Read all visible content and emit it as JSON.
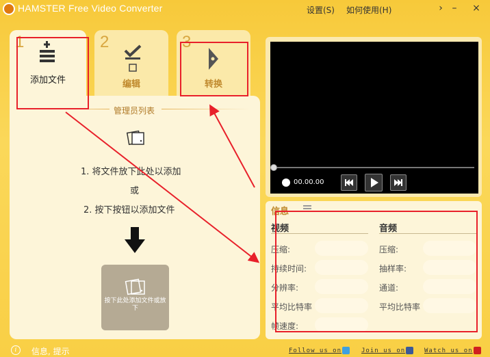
{
  "app": {
    "title": "HAMSTER Free Video Converter",
    "menu": {
      "settings": "设置(S)",
      "howto": "如何使用(H)"
    },
    "window_controls": {
      "arrow": "›",
      "minimize": "–",
      "close": "×"
    }
  },
  "tabs": [
    {
      "number": "1",
      "label": "添加文件",
      "icon": "file-list-add-icon"
    },
    {
      "number": "2",
      "label": "编辑",
      "icon": "checklist-icon"
    },
    {
      "number": "3",
      "label": "转换",
      "icon": "play-arrow-icon"
    }
  ],
  "file_list": {
    "title": "管理员列表",
    "instruction_1": "1.  将文件放下此处以添加",
    "or": "或",
    "instruction_2": "2.  按下按钮以添加文件",
    "add_button_label": "按下此处添加文件或放下"
  },
  "player": {
    "time": "00.00.00",
    "progress": 0
  },
  "info": {
    "title": "信息",
    "video": {
      "heading": "视频",
      "labels": [
        "压缩:",
        "持续时间:",
        "分辨率:",
        "平均比特率",
        "帧速度:"
      ]
    },
    "audio": {
      "heading": "音频",
      "labels": [
        "压缩:",
        "抽样率:",
        "通道:",
        "平均比特率"
      ]
    }
  },
  "status": {
    "text": "信息, 提示",
    "social": {
      "follow": "Follow us on",
      "join": "Join us on",
      "watch": "Watch us on"
    }
  },
  "colors": {
    "background": "#f9cf45",
    "panel": "#fdf5d9",
    "accent": "#c08a2e",
    "annotation_red": "#e8202a"
  }
}
